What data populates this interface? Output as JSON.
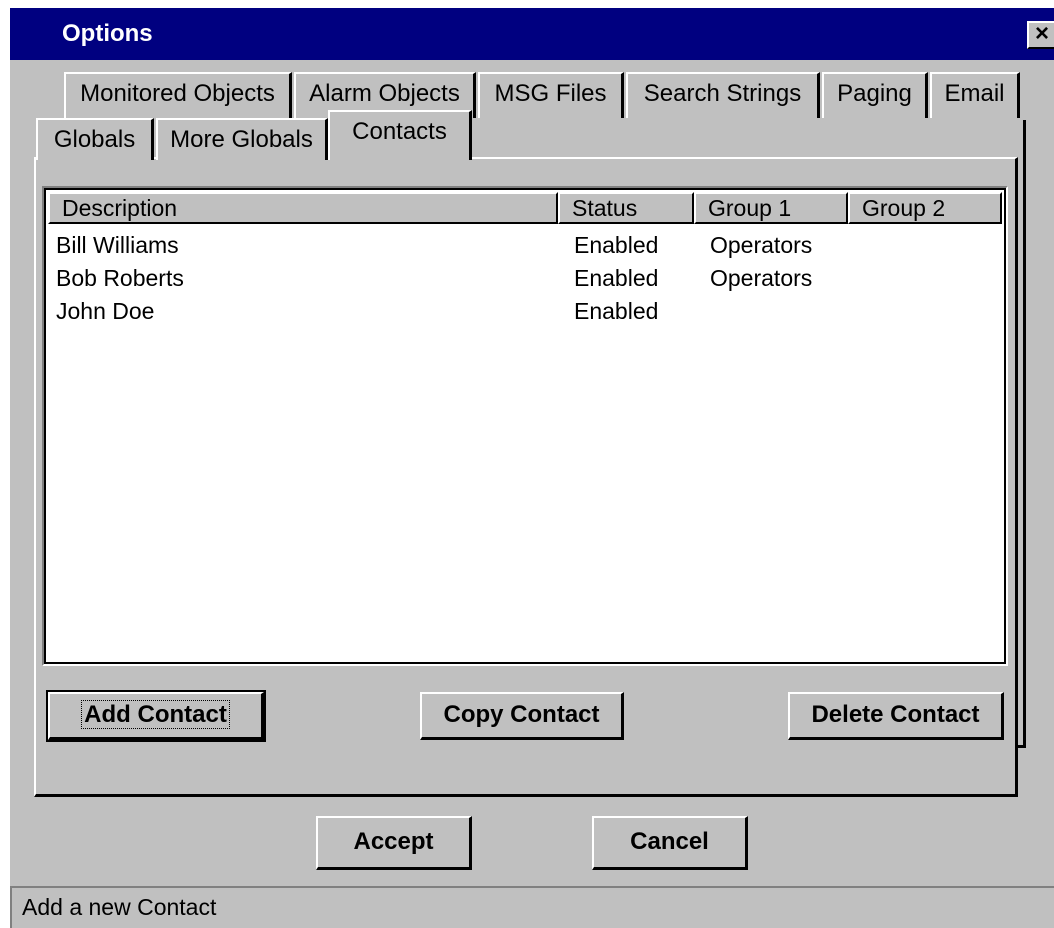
{
  "window": {
    "title": "Options",
    "close_glyph": "×"
  },
  "tabs_row1": [
    "Monitored Objects",
    "Alarm Objects",
    "MSG Files",
    "Search Strings",
    "Paging",
    "Email"
  ],
  "tabs_row2": [
    "Globals",
    "More Globals",
    "Contacts"
  ],
  "active_tab": "Contacts",
  "table": {
    "headers": [
      "Description",
      "Status",
      "Group 1",
      "Group 2"
    ],
    "rows": [
      [
        "Bill Williams",
        "Enabled",
        "Operators",
        ""
      ],
      [
        "Bob Roberts",
        "Enabled",
        "Operators",
        ""
      ],
      [
        "John Doe",
        "Enabled",
        "",
        ""
      ]
    ]
  },
  "buttons": {
    "add": "Add Contact",
    "copy": "Copy Contact",
    "delete": "Delete Contact",
    "accept": "Accept",
    "cancel": "Cancel"
  },
  "status_text": "Add a new Contact"
}
